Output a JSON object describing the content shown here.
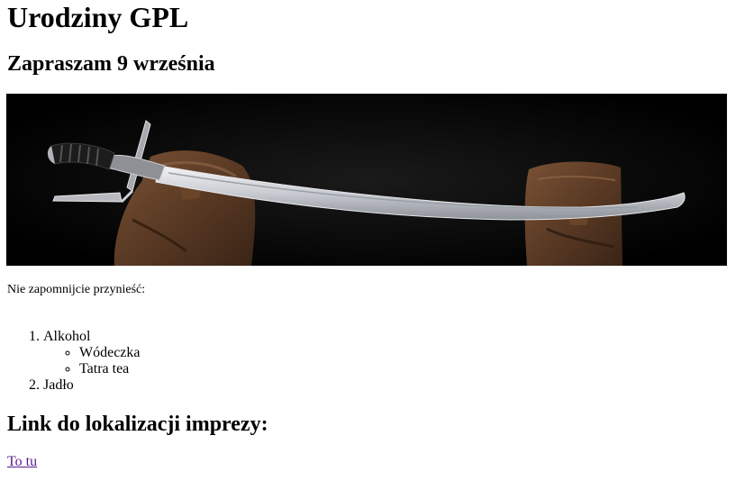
{
  "page": {
    "title": "Urodziny GPL",
    "subtitle": "Zapraszam 9 września",
    "banner_icon": "saber-image",
    "note": "Nie zapomnijcie przynieść:",
    "list": [
      {
        "label": "Alkohol",
        "subitems": [
          "Wódeczka",
          "Tatra tea"
        ]
      },
      {
        "label": "Jadło"
      }
    ],
    "link_heading": "Link do lokalizacji imprezy:",
    "link_text": "To tu",
    "link_color": "#551a8b"
  }
}
